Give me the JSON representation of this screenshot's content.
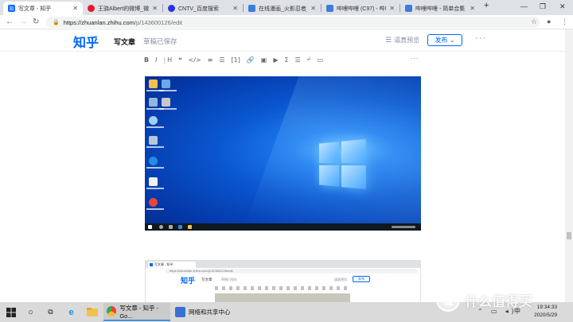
{
  "browser": {
    "tabs": [
      {
        "label": "写文章 - 知乎",
        "favicon": "zhihu-icon",
        "color": "#0066ff",
        "active": true
      },
      {
        "label": "王骁Albert的微博_微博",
        "favicon": "weibo-icon",
        "color": "#e6162d"
      },
      {
        "label": "CNTV_百度搜索",
        "favicon": "baidu-icon",
        "color": "#2932e1"
      },
      {
        "label": "在线漫画_火影忍者_海贼王",
        "favicon": "page-icon",
        "color": "#3b7ddd"
      },
      {
        "label": "哔哩哔哩 (C97) - 哔哩哔哩",
        "favicon": "page-icon",
        "color": "#3b7ddd"
      },
      {
        "label": "哔哩哔哩 - 简单合集",
        "favicon": "page-icon",
        "color": "#3b7ddd"
      }
    ],
    "new_tab": "+",
    "url_host": "https://zhuanlan.zhihu.com",
    "url_path": "/p/143600126/edit"
  },
  "zhihu": {
    "logo": "知乎",
    "page_title": "写文章",
    "save_status": "草稿已保存",
    "preview_label": "逼真预览",
    "publish_label": "发布 ⌄",
    "more_label": "···"
  },
  "editor_toolbar": [
    "B",
    "I",
    "H",
    "❝",
    "</>",
    "≡",
    "☰",
    "[1]",
    "🔗",
    "▣",
    "▶",
    "Σ",
    "☰",
    "⌿",
    "▭"
  ],
  "editor_more": "···",
  "embedded_screenshot": {
    "tab_label": "写文章 - 知乎",
    "url": "https://zhuanlan.zhihu.com/p/143600126/edit",
    "logo": "知乎",
    "title": "写文章",
    "saved": "草稿已保存",
    "preview": "逼真预览",
    "publish": "发布"
  },
  "taskbar": {
    "apps": [
      {
        "label": "写文章 - 知乎 - Go...",
        "icon": "chrome-icon",
        "color": "#e8453c",
        "active": true
      },
      {
        "label": "网络和共享中心",
        "icon": "network-icon",
        "color": "#3b6fd4",
        "active": false
      }
    ],
    "ime": "中",
    "time": "19:34:33",
    "date": "2020/5/29"
  },
  "watermark": {
    "badge": "值",
    "text": "什么值得买"
  }
}
